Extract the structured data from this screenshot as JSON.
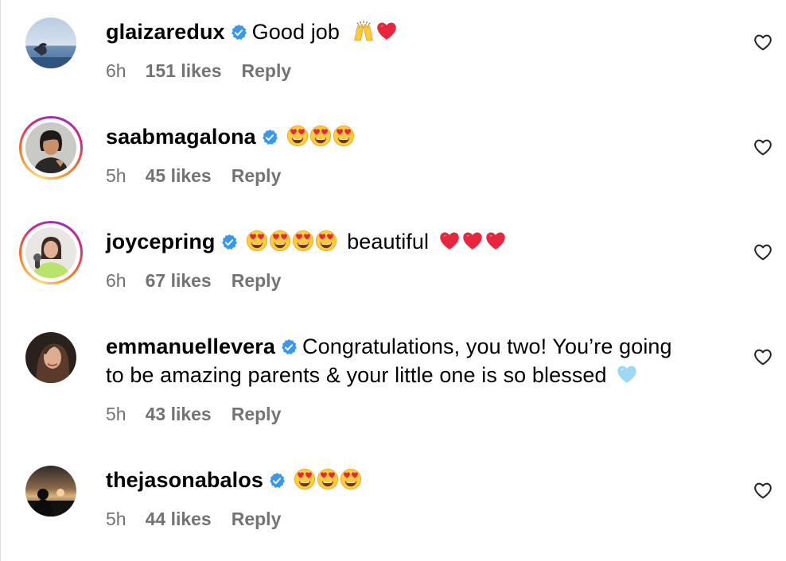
{
  "colors": {
    "verified": "#3897f0",
    "meta_text": "#737373",
    "story_ring": [
      "#feda75",
      "#fa7e1e",
      "#d62976",
      "#962fbf"
    ]
  },
  "icons": {
    "verified": "verified-badge-icon",
    "like": "heart-outline-icon",
    "emoji_heart_eyes": "heart-eyes-emoji",
    "emoji_red_heart": "red-heart-emoji",
    "emoji_raising_hands": "raising-hands-emoji",
    "emoji_light_blue_heart": "light-blue-heart-emoji"
  },
  "comments": [
    {
      "username": "glaizaredux",
      "text": "Good job",
      "emoji": [
        "raising-hands",
        "red-heart"
      ],
      "time": "6h",
      "likes": "151 likes",
      "reply": "Reply",
      "story_ring": false
    },
    {
      "username": "saabmagalona",
      "text": "",
      "emoji": [
        "heart-eyes",
        "heart-eyes",
        "heart-eyes"
      ],
      "time": "5h",
      "likes": "45 likes",
      "reply": "Reply",
      "story_ring": true
    },
    {
      "username": "joycepring",
      "text": "beautiful",
      "emoji_before": [
        "heart-eyes",
        "heart-eyes",
        "heart-eyes",
        "heart-eyes"
      ],
      "emoji_after": [
        "red-heart",
        "red-heart",
        "red-heart"
      ],
      "time": "6h",
      "likes": "67 likes",
      "reply": "Reply",
      "story_ring": true
    },
    {
      "username": "emmanuellevera",
      "text_line1": "Congratulations, you two! You’re going",
      "text_line2": "to be amazing parents & your little one is so blessed",
      "emoji": [
        "light-blue-heart"
      ],
      "time": "5h",
      "likes": "43 likes",
      "reply": "Reply",
      "story_ring": false
    },
    {
      "username": "thejasonabalos",
      "text": "",
      "emoji": [
        "heart-eyes",
        "heart-eyes",
        "heart-eyes"
      ],
      "time": "5h",
      "likes": "44 likes",
      "reply": "Reply",
      "story_ring": false
    }
  ]
}
